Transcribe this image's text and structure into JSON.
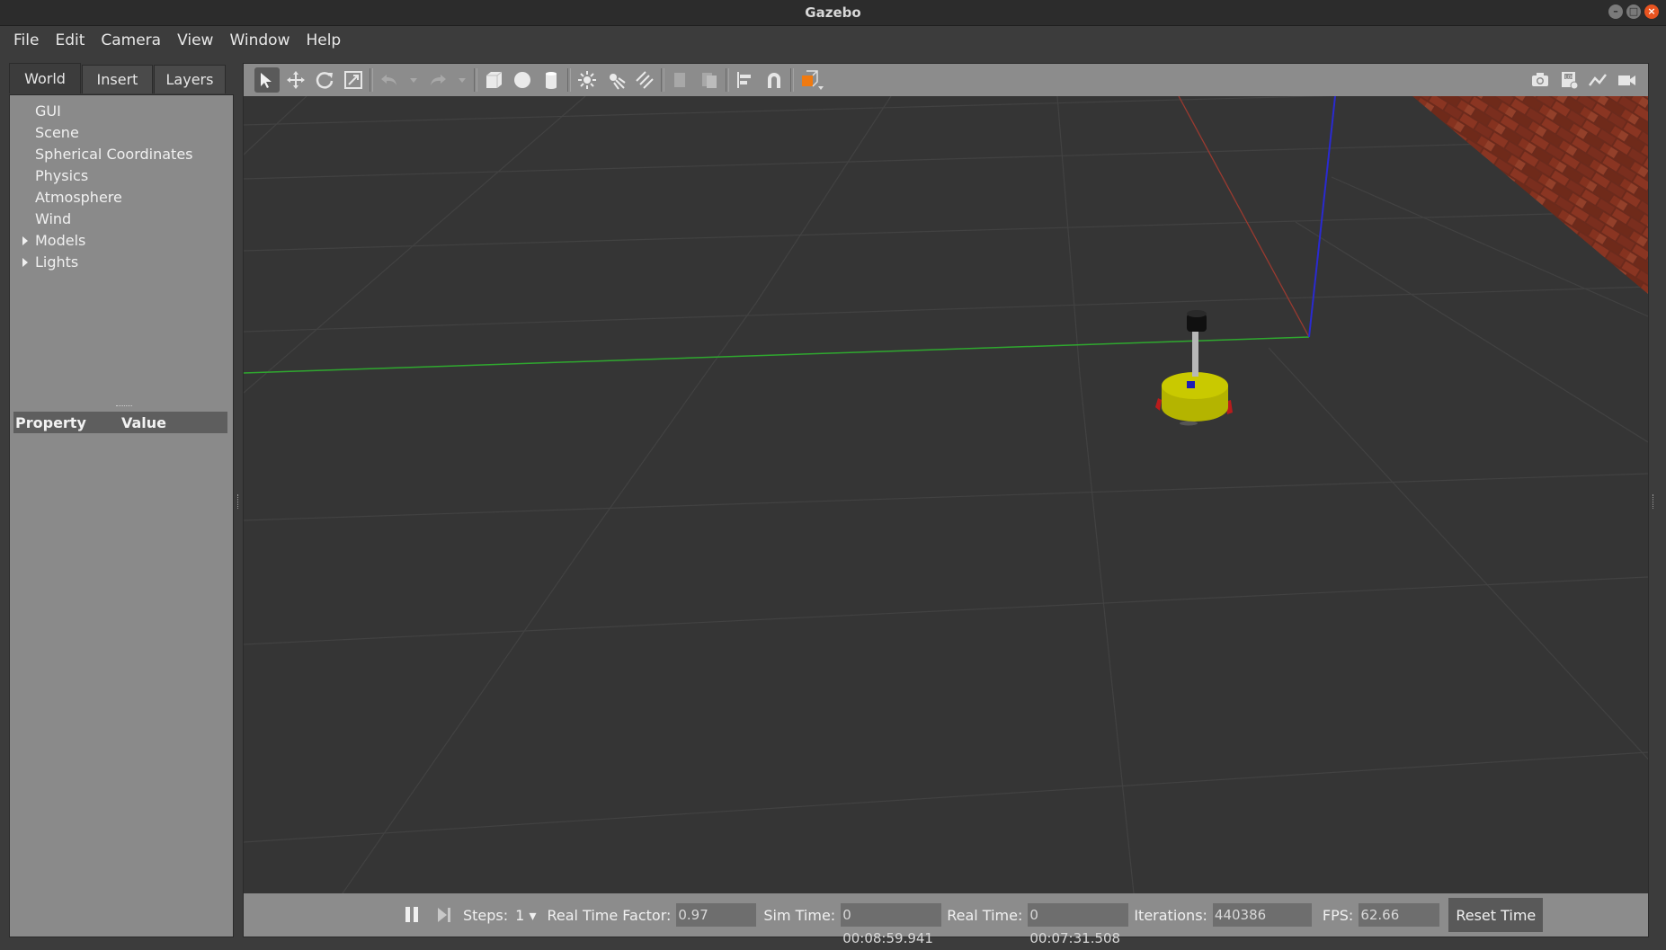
{
  "window": {
    "title": "Gazebo"
  },
  "menu": [
    "File",
    "Edit",
    "Camera",
    "View",
    "Window",
    "Help"
  ],
  "tabs": [
    "World",
    "Insert",
    "Layers"
  ],
  "tree": [
    {
      "label": "GUI",
      "expandable": false
    },
    {
      "label": "Scene",
      "expandable": false
    },
    {
      "label": "Spherical Coordinates",
      "expandable": false
    },
    {
      "label": "Physics",
      "expandable": false
    },
    {
      "label": "Atmosphere",
      "expandable": false
    },
    {
      "label": "Wind",
      "expandable": false
    },
    {
      "label": "Models",
      "expandable": true
    },
    {
      "label": "Lights",
      "expandable": true
    }
  ],
  "properties": {
    "header_property": "Property",
    "header_value": "Value"
  },
  "toolbar": {
    "tools": [
      "select-mode",
      "translate-mode",
      "rotate-mode",
      "scale-mode",
      "undo",
      "undo-history",
      "redo",
      "redo-history",
      "box",
      "sphere",
      "cylinder",
      "point-light",
      "spot-light",
      "directional-light",
      "copy",
      "paste",
      "align",
      "snap",
      "view-angle"
    ],
    "right_tools": [
      "screenshot",
      "log-data",
      "plot",
      "record-video"
    ]
  },
  "bottom": {
    "steps_label": "Steps:",
    "steps_value": "1",
    "rtf_label": "Real Time Factor:",
    "rtf_value": "0.97",
    "sim_label": "Sim Time:",
    "sim_value": "0 00:08:59.941",
    "real_label": "Real Time:",
    "real_value": "0 00:07:31.508",
    "iter_label": "Iterations:",
    "iter_value": "440386",
    "fps_label": "FPS:",
    "fps_value": "62.66",
    "reset_label": "Reset Time"
  },
  "colors": {
    "accent_close": "#e95420",
    "robot_body": "#b4b400",
    "x_axis": "#c0302a",
    "y_axis": "#2fa82f",
    "z_axis": "#2a2ad0"
  }
}
